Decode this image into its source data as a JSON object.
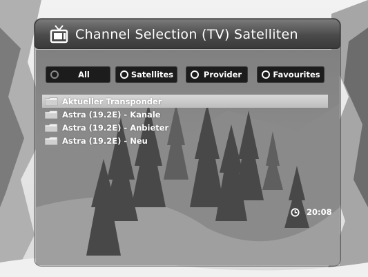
{
  "window": {
    "title": "Channel Selection  (TV) Satelliten",
    "icon": "tv-icon"
  },
  "filters": [
    {
      "label": "All",
      "icon": "radio-icon",
      "active": false
    },
    {
      "label": "Satellites",
      "icon": "radio-icon",
      "active": true
    },
    {
      "label": "Provider",
      "icon": "radio-icon",
      "active": true
    },
    {
      "label": "Favourites",
      "icon": "radio-icon",
      "active": true
    }
  ],
  "list": {
    "items": [
      {
        "label": "Aktueller Transponder",
        "icon": "folder-icon",
        "selected": true
      },
      {
        "label": "Astra (19.2E) - Kanale",
        "icon": "folder-icon",
        "selected": false
      },
      {
        "label": "Astra (19.2E) - Anbieter",
        "icon": "folder-icon",
        "selected": false
      },
      {
        "label": "Astra (19.2E) - Neu",
        "icon": "folder-icon",
        "selected": false
      }
    ]
  },
  "status": {
    "time": "20:08",
    "time_icon": "clock-icon"
  },
  "colors": {
    "panel": "#3a3a3a",
    "button": "#1c1c1c",
    "selection": "#cfcfcf",
    "text": "#ffffff"
  }
}
